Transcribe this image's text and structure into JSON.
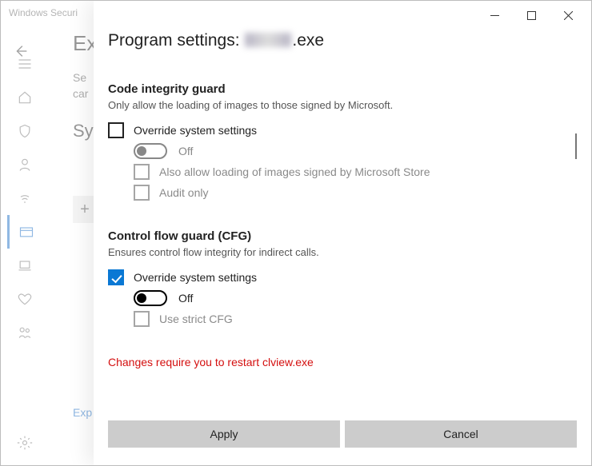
{
  "bg": {
    "window_title": "Windows Securi",
    "heading_crop": "Ex",
    "sub1_crop": "Se",
    "sub2_crop": "car",
    "heading2_crop": "Sy",
    "add_plus": "+",
    "link_crop": "Exp"
  },
  "dialog": {
    "title_prefix": "Program settings: ",
    "title_suffix": ".exe",
    "sections": {
      "cig": {
        "heading": "Code integrity guard",
        "desc": "Only allow the loading of images to those signed by Microsoft.",
        "override_label": "Override system settings",
        "off_label": "Off",
        "ms_store_label": "Also allow loading of images signed by Microsoft Store",
        "audit_label": "Audit only"
      },
      "cfg": {
        "heading": "Control flow guard (CFG)",
        "desc": "Ensures control flow integrity for indirect calls.",
        "override_label": "Override system settings",
        "off_label": "Off",
        "strict_label": "Use strict CFG"
      }
    },
    "warning": "Changes require you to restart clview.exe",
    "apply": "Apply",
    "cancel": "Cancel"
  }
}
